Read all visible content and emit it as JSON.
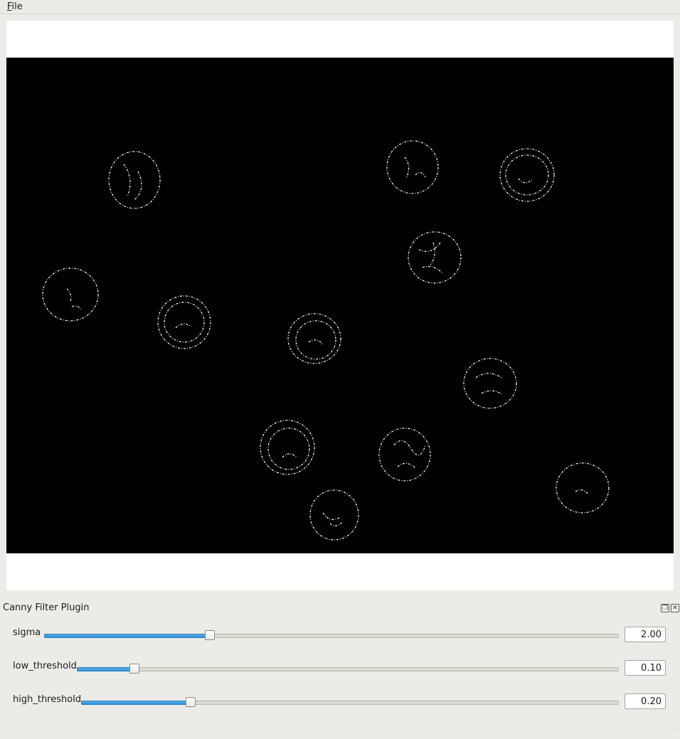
{
  "menubar": {
    "file_accel": "F",
    "file_rest": "ile"
  },
  "dock": {
    "title": "Canny Filter Plugin",
    "float_icon": "restore-icon",
    "close_icon": "close-icon"
  },
  "params": [
    {
      "label": "sigma",
      "value": "2.00",
      "fraction": 0.288
    },
    {
      "label": "low_threshold",
      "value": "0.10",
      "fraction": 0.106
    },
    {
      "label": "high_threshold",
      "value": "0.20",
      "fraction": 0.204
    }
  ],
  "colors": {
    "canvas_background": "#000000",
    "edge_color": "#ffffff",
    "slider_fill": "#3a97dc",
    "window_background": "#edebe7"
  }
}
